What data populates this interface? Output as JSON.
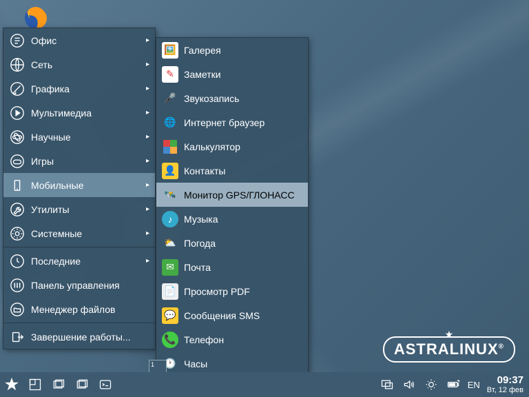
{
  "brand": {
    "name": "ASTRALINUX",
    "reg": "®"
  },
  "menu": {
    "items": [
      {
        "label": "Офис",
        "arrow": "▸"
      },
      {
        "label": "Сеть",
        "arrow": "▸"
      },
      {
        "label": "Графика",
        "arrow": "▸"
      },
      {
        "label": "Мультимедиа",
        "arrow": "▸"
      },
      {
        "label": "Научные",
        "arrow": "▸"
      },
      {
        "label": "Игры",
        "arrow": "▸"
      },
      {
        "label": "Мобильные",
        "arrow": "▸"
      },
      {
        "label": "Утилиты",
        "arrow": "▸"
      },
      {
        "label": "Системные",
        "arrow": "▸"
      }
    ],
    "bottom": [
      {
        "label": "Последние",
        "arrow": "▸"
      },
      {
        "label": "Панель управления"
      },
      {
        "label": "Менеджер файлов"
      }
    ],
    "shutdown": {
      "label": "Завершение работы..."
    }
  },
  "submenu": {
    "items": [
      {
        "label": "Галерея"
      },
      {
        "label": "Заметки"
      },
      {
        "label": "Звукозапись"
      },
      {
        "label": "Интернет браузер"
      },
      {
        "label": "Калькулятор"
      },
      {
        "label": "Контакты"
      },
      {
        "label": "Монитор GPS/ГЛОНАСС"
      },
      {
        "label": "Музыка"
      },
      {
        "label": "Погода"
      },
      {
        "label": "Почта"
      },
      {
        "label": "Просмотр PDF"
      },
      {
        "label": "Сообщения SMS"
      },
      {
        "label": "Телефон"
      },
      {
        "label": "Часы"
      }
    ]
  },
  "taskbar": {
    "workspace": "1",
    "lang": "EN",
    "time": "09:37",
    "date": "Вт, 12 фев"
  }
}
